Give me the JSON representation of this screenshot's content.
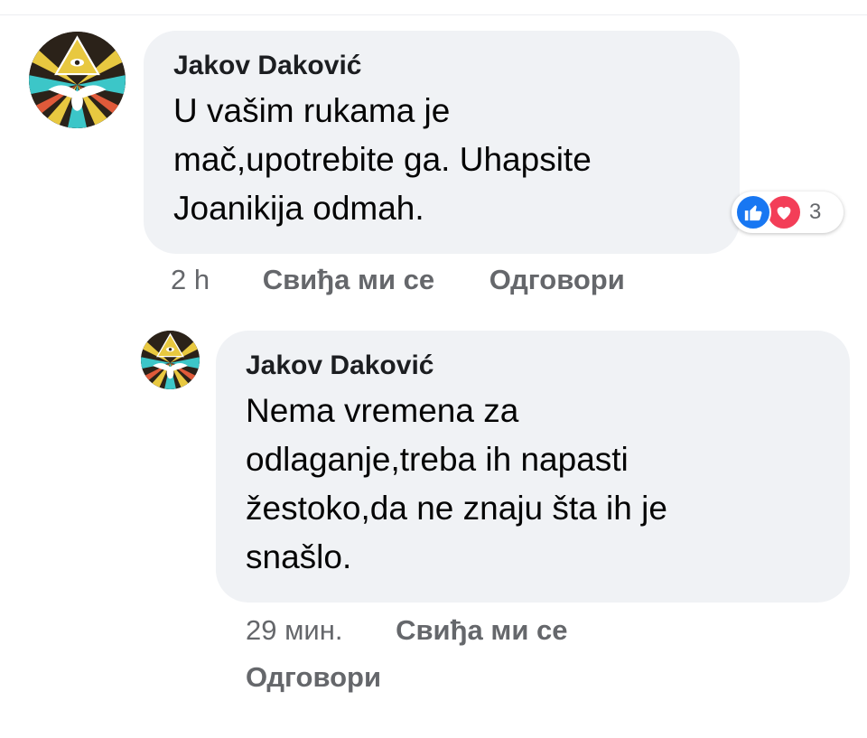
{
  "comments": [
    {
      "author": "Jakov Daković",
      "text": "U vašim rukama je mač,upotrebite ga. Uhapsite Joanikija odmah.",
      "time": "2 h",
      "like_label": "Свиђа ми се",
      "reply_label": "Одговори",
      "reactions": {
        "types": [
          "like-icon",
          "love-icon"
        ],
        "count": "3"
      }
    }
  ],
  "reply": {
    "author": "Jakov Daković",
    "text": "Nema vremena za odlaganje,treba ih napasti žestoko,da ne znaju šta ih je snašlo.",
    "time": "29 мин.",
    "like_label": "Свиђа ми се",
    "reply_label": "Одговори"
  },
  "colors": {
    "bubble": "#f0f2f5",
    "meta": "#65676b",
    "like": "#1877f2",
    "love": "#f33e58"
  },
  "icons": {
    "avatar": "all-seeing-eye-dove-avatar"
  }
}
